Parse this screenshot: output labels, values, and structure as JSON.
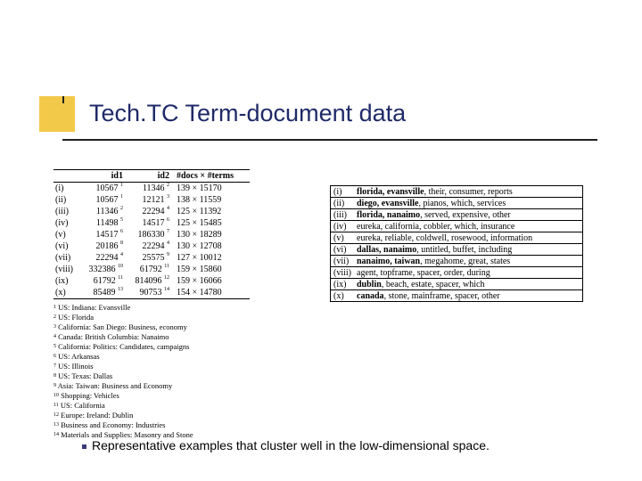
{
  "title": "Tech.TC Term-document data",
  "left_table": {
    "headers": {
      "id1": "id1",
      "id2": "id2",
      "dt": "#docs × #terms"
    },
    "rows": [
      {
        "rn": "(i)",
        "id1": "10567",
        "s1": "1",
        "id2": "11346",
        "s2": "2",
        "dt": "139 × 15170"
      },
      {
        "rn": "(ii)",
        "id1": "10567",
        "s1": "1",
        "id2": "12121",
        "s2": "3",
        "dt": "138 × 11559"
      },
      {
        "rn": "(iii)",
        "id1": "11346",
        "s1": "2",
        "id2": "22294",
        "s2": "4",
        "dt": "125 × 11392"
      },
      {
        "rn": "(iv)",
        "id1": "11498",
        "s1": "5",
        "id2": "14517",
        "s2": "6",
        "dt": "125 × 15485"
      },
      {
        "rn": "(v)",
        "id1": "14517",
        "s1": "6",
        "id2": "186330",
        "s2": "7",
        "dt": "130 × 18289"
      },
      {
        "rn": "(vi)",
        "id1": "20186",
        "s1": "8",
        "id2": "22294",
        "s2": "4",
        "dt": "130 × 12708"
      },
      {
        "rn": "(vii)",
        "id1": "22294",
        "s1": "4",
        "id2": "25575",
        "s2": "9",
        "dt": "127 × 10012"
      },
      {
        "rn": "(viii)",
        "id1": "332386",
        "s1": "10",
        "id2": "61792",
        "s2": "11",
        "dt": "159 × 15860"
      },
      {
        "rn": "(ix)",
        "id1": "61792",
        "s1": "11",
        "id2": "814096",
        "s2": "12",
        "dt": "159 × 16066"
      },
      {
        "rn": "(x)",
        "id1": "85489",
        "s1": "13",
        "id2": "90753",
        "s2": "14",
        "dt": "154 × 14780"
      }
    ]
  },
  "footnotes": [
    "US: Indiana: Evansville",
    "US: Florida",
    "California: San Diego: Business, economy",
    "Canada: British Columbia: Nanaimo",
    "California: Politics: Candidates, campaigns",
    "US: Arkansas",
    "US: Illinois",
    "US: Texas: Dallas",
    "Asia: Taiwan: Business and Economy",
    "Shopping: Vehicles",
    "US: California",
    "Europe: Ireland: Dublin",
    "Business and Economy: Industries",
    "Materials and Supplies: Masonry and Stone"
  ],
  "right_table": [
    {
      "rn": "(i)",
      "bold": "florida, evansville",
      "rest": ", their, consumer, reports"
    },
    {
      "rn": "(ii)",
      "bold": "diego, evansville",
      "rest": ", pianos, which, services"
    },
    {
      "rn": "(iii)",
      "bold": "florida, nanaimo",
      "rest": ", served, expensive, other"
    },
    {
      "rn": "(iv)",
      "bold": "",
      "rest": "eureka, california, cobbler, which, insurance"
    },
    {
      "rn": "(v)",
      "bold": "",
      "rest": "eureka, reliable, coldwell, rosewood, information"
    },
    {
      "rn": "(vi)",
      "bold": "dallas, nanaimo",
      "rest": ", untitled, buffet, including"
    },
    {
      "rn": "(vii)",
      "bold": "nanaimo, taiwan",
      "rest": ", megahome, great, states"
    },
    {
      "rn": "(viii)",
      "bold": "",
      "rest": "agent, topframe, spacer, order, during"
    },
    {
      "rn": "(ix)",
      "bold": "dublin",
      "rest": ", beach, estate, spacer, which"
    },
    {
      "rn": "(x)",
      "bold": "canada",
      "rest": ", stone, mainframe, spacer, other"
    }
  ],
  "bullet": "Representative examples that cluster well in the low-dimensional space."
}
